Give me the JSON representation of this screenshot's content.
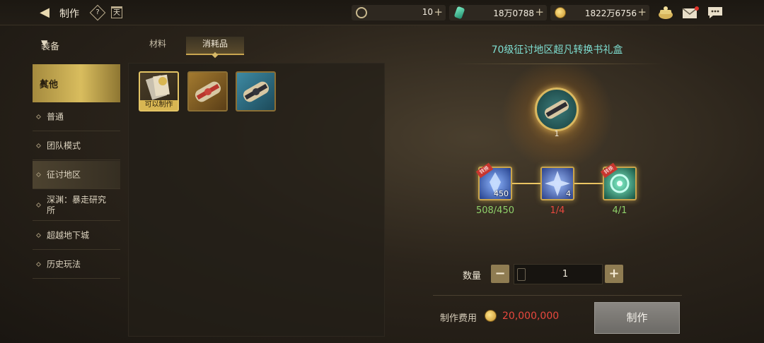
{
  "header": {
    "title": "制作",
    "help_glyph": "?",
    "calendar_glyph": "天",
    "currencies": [
      {
        "icon": "ticket-coin-icon",
        "value": "10"
      },
      {
        "icon": "green-crystal-icon",
        "value": "18万0788"
      },
      {
        "icon": "gold-coin-icon",
        "value": "1822万6756"
      }
    ]
  },
  "sidebar": {
    "category": "装备",
    "active_category": "其他",
    "items": [
      "普通",
      "团队模式",
      "征讨地区",
      "深渊：暴走研究所",
      "超越地下城",
      "历史玩法"
    ],
    "active_index": 2
  },
  "tabs": [
    "材料",
    "消耗品"
  ],
  "active_tab": 1,
  "grid": {
    "items": [
      {
        "name": "recipe-book-item",
        "badge": "可以制作"
      },
      {
        "name": "red-ribbon-scroll-item",
        "badge": ""
      },
      {
        "name": "blue-scroll-item",
        "badge": ""
      }
    ]
  },
  "detail": {
    "title": "70级征讨地区超凡转换书礼盒",
    "product_count": "1",
    "materials": [
      {
        "icon": "blue-crystal-icon",
        "qty": "450",
        "owned": "508/450",
        "status": "enough",
        "ribbon": "转换"
      },
      {
        "icon": "blue-crystal-shard-icon",
        "qty": "4",
        "owned": "1/4",
        "status": "lacking",
        "ribbon": ""
      },
      {
        "icon": "green-orb-icon",
        "qty": "",
        "owned": "4/1",
        "status": "enough",
        "ribbon": "转换"
      }
    ]
  },
  "quantity": {
    "label": "数量",
    "value": "1",
    "minus": "−",
    "plus": "+"
  },
  "cost": {
    "label": "制作费用",
    "value": "20,000,000"
  },
  "craft_button": "制作",
  "colors": {
    "accent_gold": "#d9b860",
    "title_cyan": "#7fdfd2",
    "enough_green": "#8fd06a",
    "lacking_red": "#e8483e"
  }
}
